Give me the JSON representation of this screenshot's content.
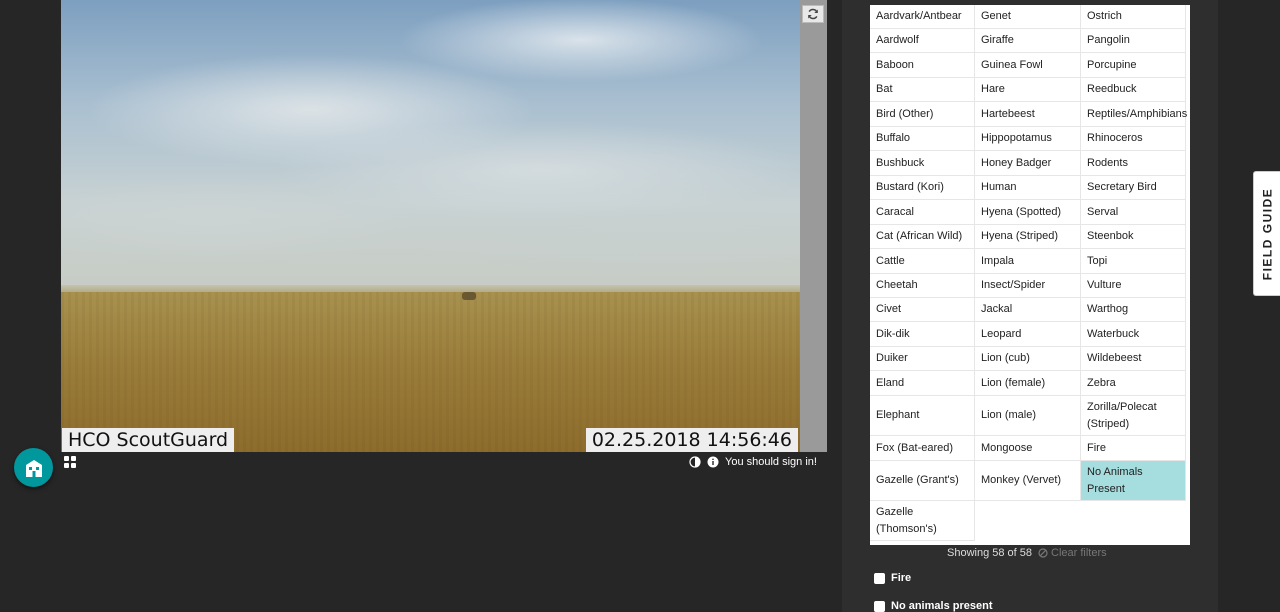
{
  "subject": {
    "stamp_left": "HCO ScoutGuard",
    "stamp_right": "02.25.2018  14:56:46"
  },
  "meta": {
    "signin_notice": "You should sign in!"
  },
  "choices": [
    "Aardvark/Antbear",
    "Aardwolf",
    "Baboon",
    "Bat",
    "Bird (Other)",
    "Buffalo",
    "Bushbuck",
    "Bustard (Kori)",
    "Caracal",
    "Cat (African Wild)",
    "Cattle",
    "Cheetah",
    "Civet",
    "Dik-dik",
    "Duiker",
    "Eland",
    "Elephant",
    "Fox (Bat-eared)",
    "Gazelle (Grant's)",
    "Gazelle (Thomson's)",
    "Genet",
    "Giraffe",
    "Guinea Fowl",
    "Hare",
    "Hartebeest",
    "Hippopotamus",
    "Honey Badger",
    "Human",
    "Hyena (Spotted)",
    "Hyena (Striped)",
    "Impala",
    "Insect/Spider",
    "Jackal",
    "Leopard",
    "Lion (cub)",
    "Lion (female)",
    "Lion (male)",
    "Mongoose",
    "Monkey (Vervet)",
    "Ostrich",
    "Pangolin",
    "Porcupine",
    "Reedbuck",
    "Reptiles/Amphibians",
    "Rhinoceros",
    "Rodents",
    "Secretary Bird",
    "Serval",
    "Steenbok",
    "Topi",
    "Vulture",
    "Warthog",
    "Waterbuck",
    "Wildebeest",
    "Zebra",
    "Zorilla/Polecat (Striped)",
    "Fire",
    "No Animals Present"
  ],
  "active_choice": "No Animals Present",
  "filter": {
    "showing": "Showing 58 of 58",
    "clear_label": "Clear filters"
  },
  "checkboxes": {
    "fire": "Fire",
    "no_animals": "No animals present"
  },
  "field_guide_label": "FIELD GUIDE"
}
